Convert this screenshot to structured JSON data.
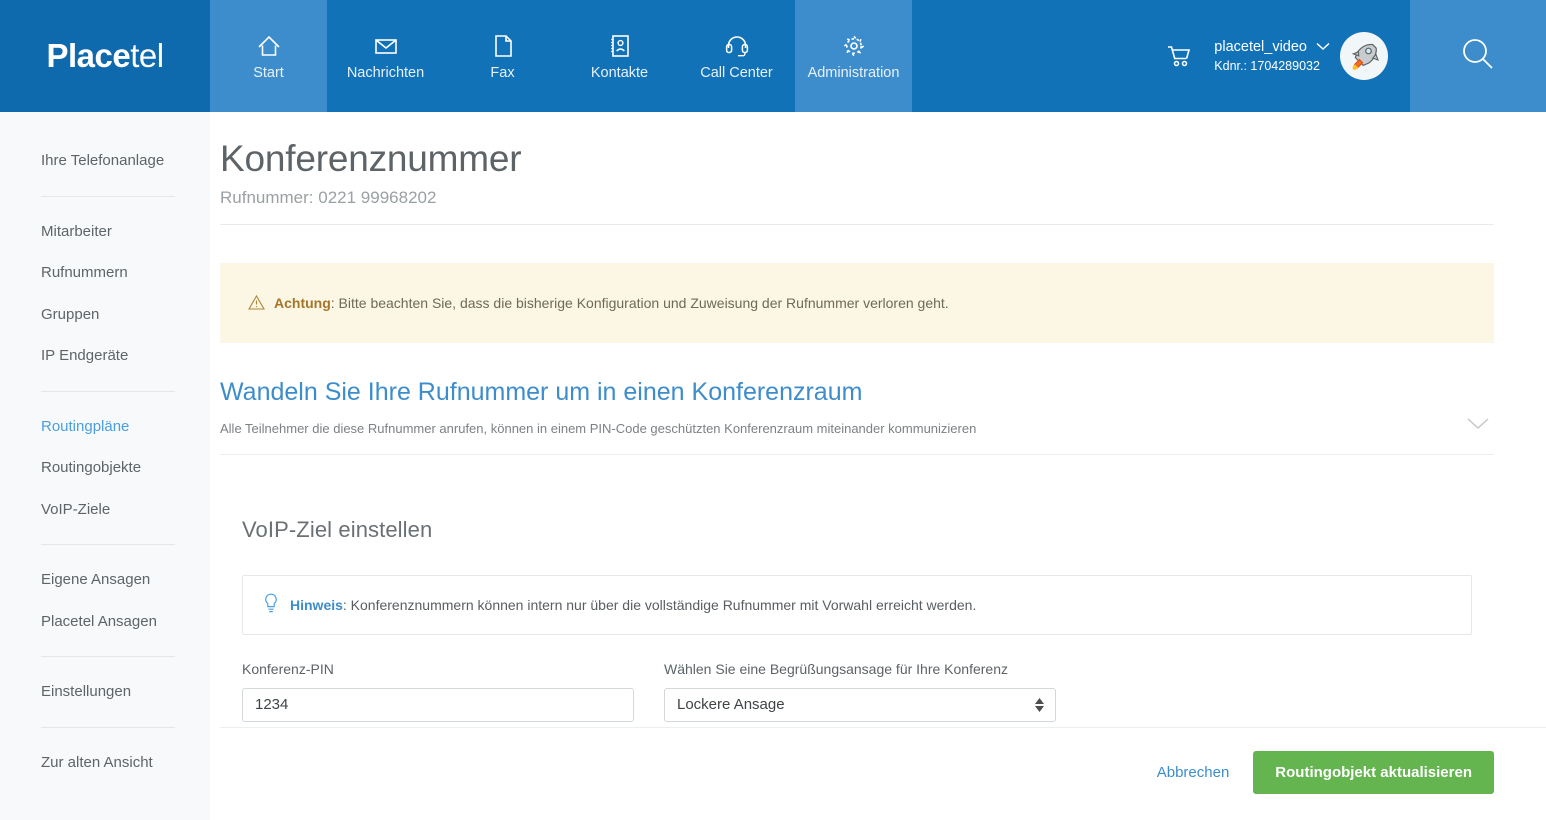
{
  "brand": {
    "name_bold": "Place",
    "name_thin": "tel",
    "accent_blue": "#3d8dcc",
    "header_blue": "#1272b8",
    "green": "#64b450"
  },
  "topnav": {
    "items": [
      {
        "label": "Start",
        "icon": "home-icon",
        "active": true
      },
      {
        "label": "Nachrichten",
        "icon": "envelope-icon",
        "active": false
      },
      {
        "label": "Fax",
        "icon": "document-icon",
        "active": false
      },
      {
        "label": "Kontakte",
        "icon": "address-book-icon",
        "active": false
      },
      {
        "label": "Call Center",
        "icon": "headset-icon",
        "active": false
      },
      {
        "label": "Administration",
        "icon": "gear-icon",
        "active": true
      }
    ],
    "cart_icon": "shopping-cart-icon",
    "user_name": "placetel_video",
    "user_kdnr": "Kdnr.: 1704289032",
    "avatar_icon": "rocket-avatar",
    "search_icon": "search-icon"
  },
  "sidebar": {
    "items": [
      {
        "label": "Ihre Telefonanlage",
        "active": false
      },
      {
        "label": "Mitarbeiter",
        "active": false
      },
      {
        "label": "Rufnummern",
        "active": false
      },
      {
        "label": "Gruppen",
        "active": false
      },
      {
        "label": "IP Endgeräte",
        "active": false
      },
      {
        "label": "Routingpläne",
        "active": true
      },
      {
        "label": "Routingobjekte",
        "active": false
      },
      {
        "label": "VoIP-Ziele",
        "active": false
      },
      {
        "label": "Eigene Ansagen",
        "active": false
      },
      {
        "label": "Placetel Ansagen",
        "active": false
      },
      {
        "label": "Einstellungen",
        "active": false
      },
      {
        "label": "Zur alten Ansicht",
        "active": false
      }
    ]
  },
  "page": {
    "title": "Konferenznummer",
    "subtitle": "Rufnummer: 0221 99968202"
  },
  "warning": {
    "icon": "warning-triangle-icon",
    "strong": "Achtung",
    "text": ": Bitte beachten Sie, dass die bisherige Konfiguration und Zuweisung der Rufnummer verloren geht."
  },
  "convert": {
    "heading": "Wandeln Sie Ihre Rufnummer um in einen Konferenzraum",
    "description": "Alle Teilnehmer die diese Rufnummer anrufen, können in einem PIN-Code geschützten Konferenzraum miteinander kommunizieren",
    "chevron_icon": "chevron-down-icon"
  },
  "panel": {
    "heading": "VoIP-Ziel einstellen",
    "hint": {
      "icon": "lightbulb-icon",
      "strong": "Hinweis",
      "text": ": Konferenznummern können intern nur über die vollständige Rufnummer mit Vorwahl erreicht werden."
    },
    "pin_label": "Konferenz-PIN",
    "pin_value": "1234",
    "pin_placeholder": "",
    "announce_label": "Wählen Sie eine Begrüßungsansage für Ihre Konferenz",
    "announce_selected": "Lockere Ansage"
  },
  "footer": {
    "cancel_label": "Abbrechen",
    "submit_label": "Routingobjekt aktualisieren"
  }
}
